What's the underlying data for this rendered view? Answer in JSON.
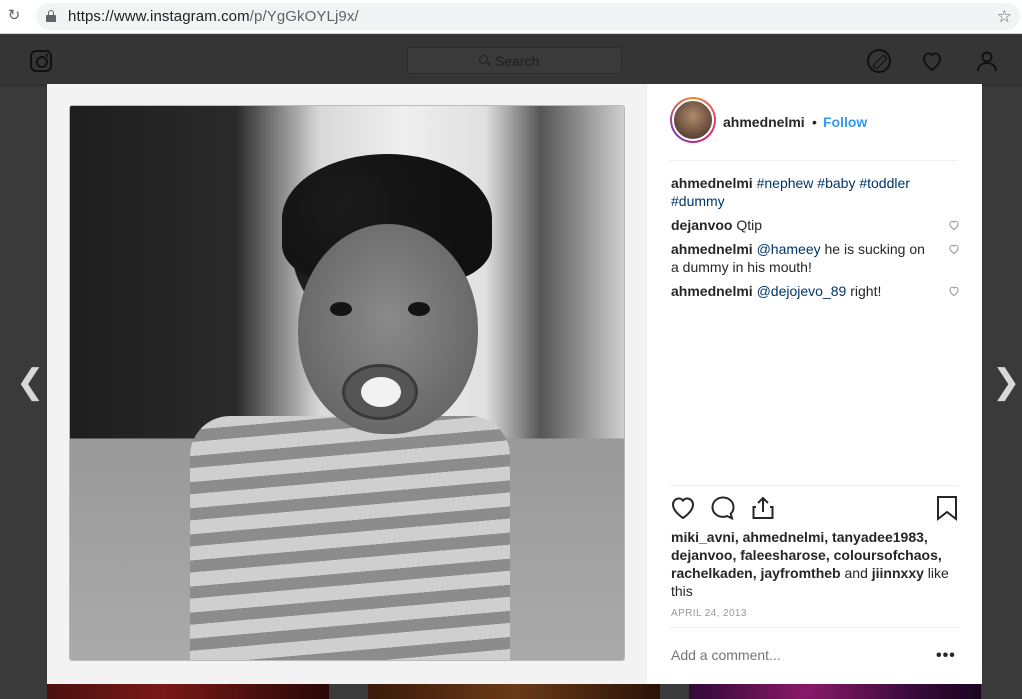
{
  "browser": {
    "url_host": "https://www.instagram.com",
    "url_path": "/p/YgGkOYLj9x/"
  },
  "header": {
    "search_placeholder": "Search"
  },
  "post": {
    "owner": "ahmednelmi",
    "separator": "•",
    "follow_label": "Follow",
    "caption": {
      "user": "ahmednelmi",
      "tags": "#nephew #baby #toddler #dummy"
    },
    "comments": [
      {
        "user": "dejanvoo",
        "mention": "",
        "text": "Qtip"
      },
      {
        "user": "ahmednelmi",
        "mention": "@hameey",
        "text": "he is sucking on a dummy in his mouth!"
      },
      {
        "user": "ahmednelmi",
        "mention": "@dejojevo_89",
        "text": "right!"
      }
    ],
    "likes": {
      "names_line": "miki_avni, ahmednelmi, tanyadee1983, dejanvoo, faleesharose, coloursofchaos, rachelkaden, jayfromtheb",
      "and": "and",
      "last": "jiinnxxy",
      "suffix": "like this"
    },
    "date": "APRIL 24, 2013",
    "add_comment_placeholder": "Add a comment...",
    "more": "•••"
  },
  "colors": {
    "link_blue": "#3897f0",
    "mention_blue": "#003569"
  }
}
